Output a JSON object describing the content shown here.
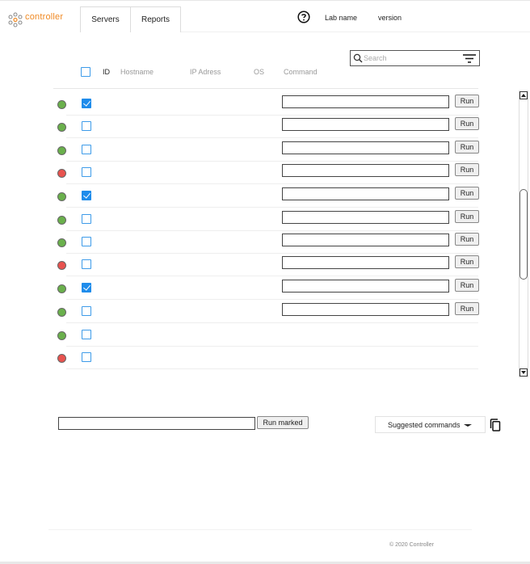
{
  "app": {
    "logo_text": "controller"
  },
  "nav": {
    "tabs": [
      {
        "label": "Servers"
      },
      {
        "label": "Reports"
      }
    ]
  },
  "header": {
    "lab_name": "Lab name",
    "version": "version"
  },
  "search": {
    "placeholder": "Search",
    "value": ""
  },
  "table": {
    "columns": [
      "ID",
      "Hostname",
      "IP Adress",
      "OS",
      "Command"
    ],
    "run_label": "Run",
    "rows": [
      {
        "status": "online",
        "checked": true,
        "has_command": true
      },
      {
        "status": "online",
        "checked": false,
        "has_command": true
      },
      {
        "status": "online",
        "checked": false,
        "has_command": true
      },
      {
        "status": "offline",
        "checked": false,
        "has_command": true
      },
      {
        "status": "online",
        "checked": true,
        "has_command": true
      },
      {
        "status": "online",
        "checked": false,
        "has_command": true
      },
      {
        "status": "online",
        "checked": false,
        "has_command": true
      },
      {
        "status": "offline",
        "checked": false,
        "has_command": true
      },
      {
        "status": "online",
        "checked": true,
        "has_command": true
      },
      {
        "status": "online",
        "checked": false,
        "has_command": true
      },
      {
        "status": "online",
        "checked": false,
        "has_command": false
      },
      {
        "status": "offline",
        "checked": false,
        "has_command": false
      }
    ]
  },
  "bulk": {
    "run_marked_label": "Run marked",
    "command_value": ""
  },
  "suggested": {
    "label": "Suggested commands"
  },
  "footer": {
    "text": "© 2020  Controller"
  },
  "colors": {
    "online": "#6ab04c",
    "offline": "#e8534f",
    "accent": "#1f8ceb",
    "logo": "#f08a24"
  },
  "icons": [
    "logo-icon",
    "help-icon",
    "search-icon",
    "filter-icon",
    "copy-icon",
    "scroll-up-icon",
    "scroll-down-icon"
  ]
}
